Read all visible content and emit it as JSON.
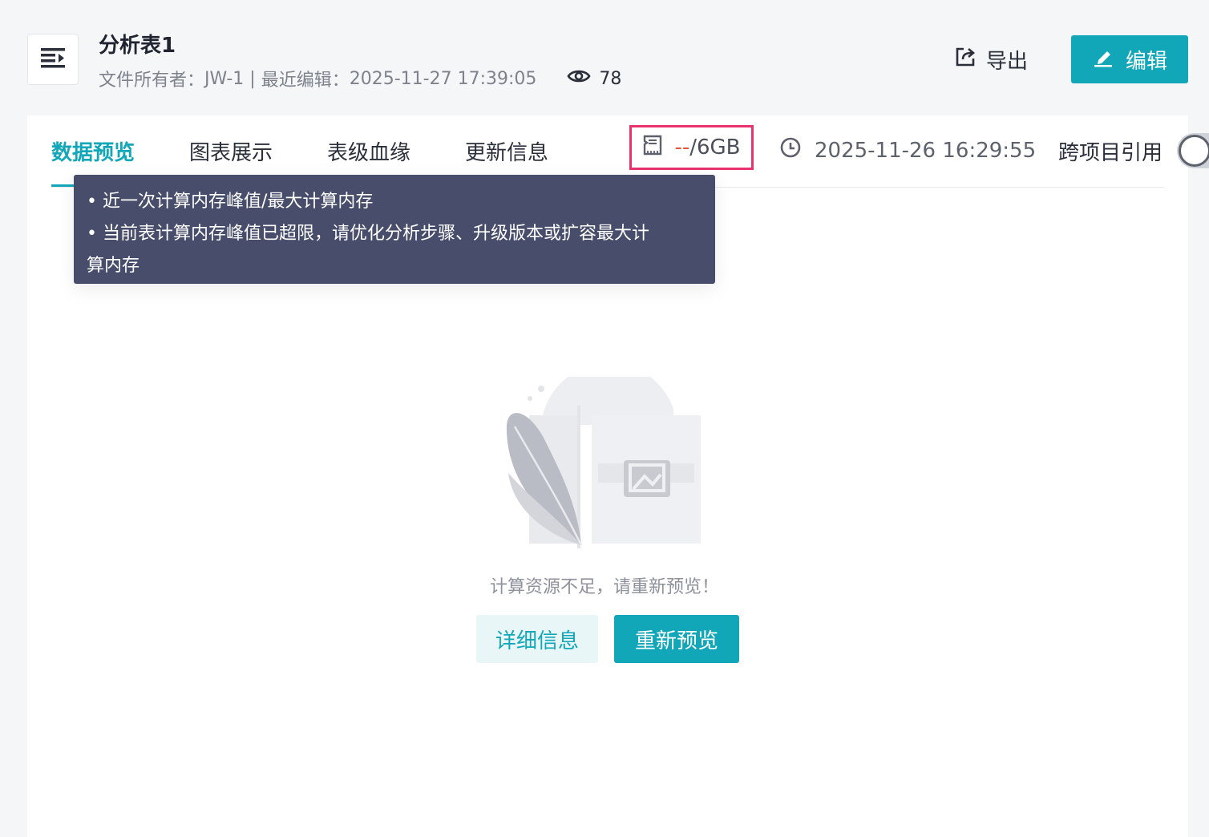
{
  "header": {
    "title": "分析表1",
    "owner_label": "文件所有者：",
    "owner": "JW-1",
    "separator": " | ",
    "last_edit_label": "最近编辑：",
    "last_edit_time": "2025-11-27 17:39:05",
    "view_count": "78",
    "export_label": "导出",
    "edit_label": "编辑"
  },
  "tabs": [
    {
      "label": "数据预览",
      "active": true
    },
    {
      "label": "图表展示",
      "active": false
    },
    {
      "label": "表级血缘",
      "active": false
    },
    {
      "label": "更新信息",
      "active": false
    }
  ],
  "memory": {
    "used": "--",
    "total": "/6GB"
  },
  "update_time": "2025-11-26 16:29:55",
  "cross_project": {
    "label": "跨项目引用",
    "enabled": false
  },
  "tooltip": {
    "line1": "• 近一次计算内存峰值/最大计算内存",
    "line2": "• 当前表计算内存峰值已超限，请优化分析步骤、升级版本或扩容最大计",
    "line3": "算内存"
  },
  "empty_state": {
    "message": "计算资源不足，请重新预览！",
    "detail_button": "详细信息",
    "retry_button": "重新预览"
  },
  "colors": {
    "accent": "#12a7b8",
    "highlight_border": "#e8336d",
    "memory_used": "#e5543b",
    "tooltip_bg": "#474d6a"
  },
  "icons": [
    "menu-collapse-icon",
    "eye-icon",
    "export-icon",
    "edit-pen-icon",
    "memory-card-icon",
    "clock-icon"
  ]
}
